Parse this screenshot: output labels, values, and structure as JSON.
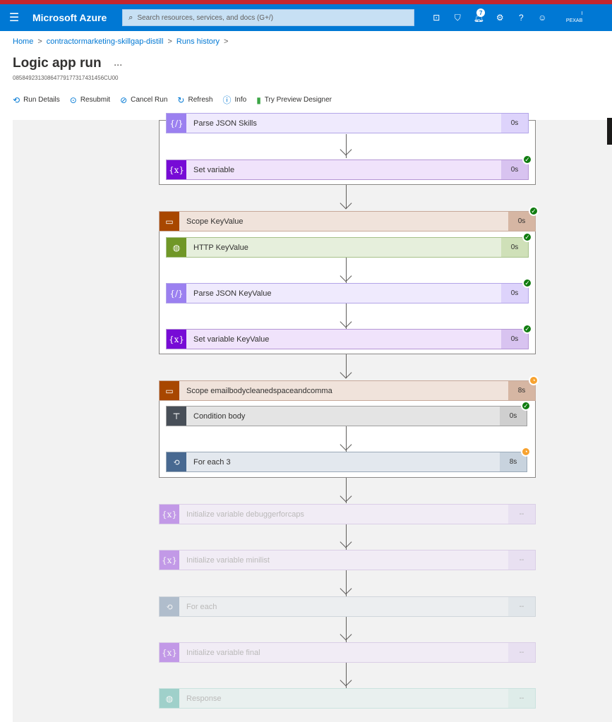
{
  "topbar": {
    "menu_icon": "hamburger-icon",
    "brand": "Microsoft Azure",
    "search_placeholder": "Search resources, services, and docs (G+/)",
    "notification_count": "7",
    "user_line1": "I",
    "user_line2": "PEXAB"
  },
  "breadcrumb": {
    "home": "Home",
    "item1": "contractormarketing-skillgap-distill",
    "item2": "Runs history",
    "sep": ">"
  },
  "page": {
    "title": "Logic app run",
    "more": "...",
    "run_id": "08584923130864779177317431456CU00"
  },
  "toolbar": {
    "run_details": "Run Details",
    "resubmit": "Resubmit",
    "cancel_run": "Cancel Run",
    "refresh": "Refresh",
    "info": "Info",
    "try_preview": "Try Preview Designer"
  },
  "steps": {
    "parse_json_skills": {
      "label": "Parse JSON Skills",
      "time": "0s"
    },
    "set_variable": {
      "label": "Set variable",
      "time": "0s"
    },
    "scope_keyvalue": {
      "label": "Scope KeyValue",
      "time": "0s"
    },
    "http_keyvalue": {
      "label": "HTTP KeyValue",
      "time": "0s"
    },
    "parse_json_keyvalue": {
      "label": "Parse JSON KeyValue",
      "time": "0s"
    },
    "set_variable_keyvalue": {
      "label": "Set variable KeyValue",
      "time": "0s"
    },
    "scope_email": {
      "label": "Scope emailbodycleanedspaceandcomma",
      "time": "8s"
    },
    "condition_body": {
      "label": "Condition body",
      "time": "0s"
    },
    "for_each_3": {
      "label": "For each 3",
      "time": "8s"
    },
    "init_debugger": {
      "label": "Initialize variable debuggerforcaps",
      "time": "--"
    },
    "init_minilist": {
      "label": "Initialize variable minilist",
      "time": "--"
    },
    "for_each": {
      "label": "For each",
      "time": "--"
    },
    "init_final": {
      "label": "Initialize variable final",
      "time": "--"
    },
    "response": {
      "label": "Response",
      "time": "--"
    }
  },
  "icons": {
    "variable": "{x}",
    "json": "{/}",
    "scope": "▭",
    "http": "◍",
    "condition": "⊤",
    "foreach": "⟲",
    "response": "◍",
    "check": "✓",
    "running": "◔"
  },
  "colors": {
    "azure_blue": "#0078d4",
    "success": "#107c10",
    "running": "#f7a22f"
  }
}
